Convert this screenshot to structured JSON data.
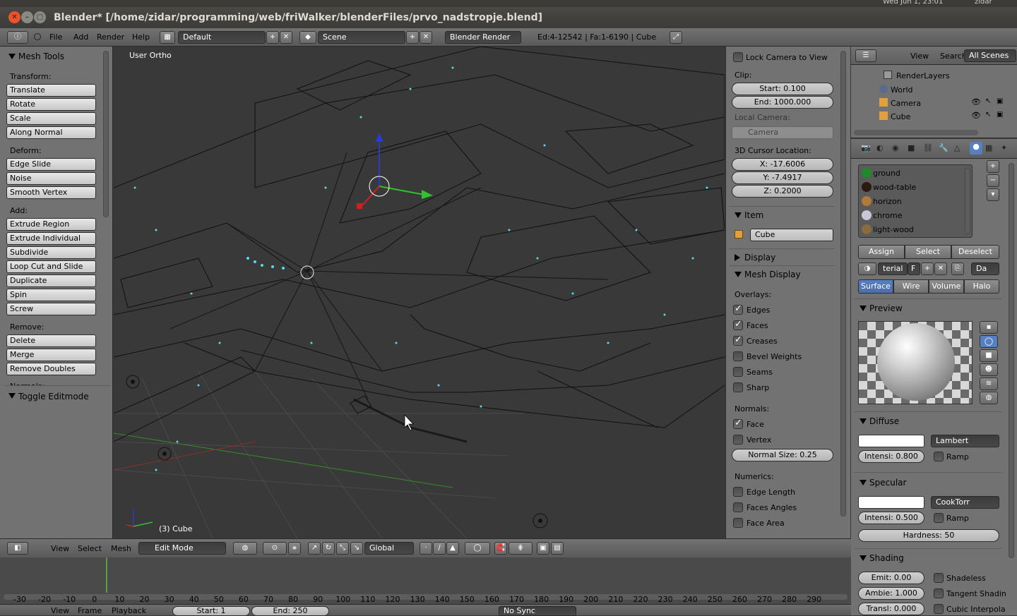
{
  "os_bar": {
    "clock": "Wed Jun 1, 23:01",
    "user": "zidar"
  },
  "window": {
    "title": "Blender* [/home/zidar/programming/web/friWalker/blenderFiles/prvo_nadstropje.blend]"
  },
  "info_header": {
    "menus": [
      "File",
      "Add",
      "Render",
      "Help"
    ],
    "screen_layout": "Default",
    "scene": "Scene",
    "render_engine": "Blender Render",
    "stats": "Ed:4-12542 | Fa:1-6190 | Cube"
  },
  "tool_shelf": {
    "title": "Mesh Tools",
    "sections": [
      {
        "label": "Transform:",
        "buttons": [
          "Translate",
          "Rotate",
          "Scale",
          "Along Normal"
        ]
      },
      {
        "label": "Deform:",
        "buttons": [
          "Edge Slide",
          "Noise",
          "Smooth Vertex"
        ]
      },
      {
        "label": "Add:",
        "buttons": [
          "Extrude Region",
          "Extrude Individual",
          "Subdivide",
          "Loop Cut and Slide",
          "Duplicate",
          "Spin",
          "Screw"
        ]
      },
      {
        "label": "Remove:",
        "buttons": [
          "Delete",
          "Merge",
          "Remove Doubles"
        ]
      }
    ],
    "cut_label": "Normals:",
    "toggle_panel": "Toggle Editmode"
  },
  "viewport": {
    "view_name": "User Ortho",
    "object_label": "(3) Cube"
  },
  "n_panel": {
    "lock_camera": "Lock Camera to View",
    "clip_label": "Clip:",
    "clip_start": "Start: 0.100",
    "clip_end": "End: 1000.000",
    "local_camera_label": "Local Camera:",
    "local_camera": "Camera",
    "cursor_label": "3D Cursor Location:",
    "cursor_x": "X: -17.6006",
    "cursor_y": "Y: -7.4917",
    "cursor_z": "Z: 0.2000",
    "item_panel": "Item",
    "item_name": "Cube",
    "display_panel": "Display",
    "mesh_display_panel": "Mesh Display",
    "overlays_label": "Overlays:",
    "overlays": [
      {
        "label": "Edges",
        "checked": true
      },
      {
        "label": "Faces",
        "checked": true
      },
      {
        "label": "Creases",
        "checked": true
      },
      {
        "label": "Bevel Weights",
        "checked": false
      },
      {
        "label": "Seams",
        "checked": false
      },
      {
        "label": "Sharp",
        "checked": false
      }
    ],
    "normals_label": "Normals:",
    "normals": [
      {
        "label": "Face",
        "checked": true
      },
      {
        "label": "Vertex",
        "checked": false
      }
    ],
    "normal_size": "Normal Size: 0.25",
    "numerics_label": "Numerics:",
    "numerics": [
      {
        "label": "Edge Length",
        "checked": false
      },
      {
        "label": "Faces Angles",
        "checked": false
      },
      {
        "label": "Face Area",
        "checked": false
      }
    ]
  },
  "outliner": {
    "menus": [
      "View",
      "Search"
    ],
    "filter": "All Scenes",
    "items": [
      "RenderLayers",
      "World",
      "Camera",
      "Cube"
    ]
  },
  "properties": {
    "materials": [
      {
        "name": "ground",
        "color": "#1e8a2a"
      },
      {
        "name": "wood-table",
        "color": "#2a1a10"
      },
      {
        "name": "horizon",
        "color": "#b07a3a"
      },
      {
        "name": "chrome",
        "color": "#c8c8d8"
      },
      {
        "name": "light-wood",
        "color": "#8a6a40"
      }
    ],
    "assign": "Assign",
    "select": "Select",
    "deselect": "Deselect",
    "material_name": "terial",
    "material_f": "F",
    "data_field": "Da",
    "mat_tabs": [
      "Surface",
      "Wire",
      "Volume",
      "Halo"
    ],
    "preview_panel": "Preview",
    "diffuse_panel": "Diffuse",
    "diffuse_shader": "Lambert",
    "diffuse_intensity": "Intensi: 0.800",
    "ramp": "Ramp",
    "specular_panel": "Specular",
    "specular_shader": "CookTorr",
    "specular_intensity": "Intensi: 0.500",
    "hardness": "Hardness: 50",
    "shading_panel": "Shading",
    "emit": "Emit: 0.00",
    "ambient": "Ambie: 1.000",
    "translucency": "Transl: 0.000",
    "shadeless": "Shadeless",
    "tangent_shading": "Tangent Shadin",
    "cubic": "Cubic Interpola"
  },
  "viewport_header": {
    "menus": [
      "View",
      "Select",
      "Mesh"
    ],
    "mode": "Edit Mode",
    "orientation": "Global"
  },
  "timeline": {
    "ticks": [
      "-30",
      "-20",
      "-10",
      "0",
      "10",
      "20",
      "30",
      "40",
      "50",
      "60",
      "70",
      "80",
      "90",
      "100",
      "110",
      "120",
      "130",
      "140",
      "150",
      "160",
      "170",
      "180",
      "190",
      "200",
      "210",
      "220",
      "230",
      "240",
      "250",
      "260",
      "270",
      "280",
      "290"
    ],
    "footer": [
      "View",
      "Frame",
      "Playback",
      "Start: 1",
      "End: 250",
      "No Sync"
    ]
  },
  "colors": {
    "accent": "#5680c2",
    "panel": "#727272",
    "viewport": "#393939",
    "wire": "#111111",
    "vertex": "#4fe0f0"
  }
}
